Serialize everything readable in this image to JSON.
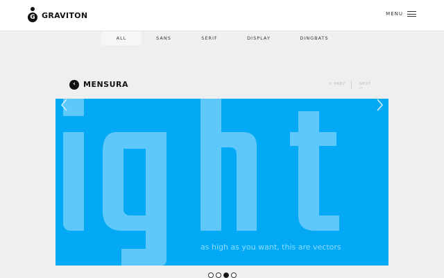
{
  "header": {
    "logo_text": "GRAVITON",
    "logo_mark_letter": "G",
    "menu_label": "MENU"
  },
  "categories": [
    {
      "label": "ALL",
      "active": true
    },
    {
      "label": "SANS",
      "active": false
    },
    {
      "label": "SERIF",
      "active": false
    },
    {
      "label": "DISPLAY",
      "active": false
    },
    {
      "label": "DINGBATS",
      "active": false
    }
  ],
  "font_view": {
    "back_icon": "chevron-left-icon",
    "font_name": "MENSURA",
    "prev_label": "< PREV",
    "next_label": "NEXT >"
  },
  "slide": {
    "display_text": "ight",
    "caption": "as high as you want, this are vectors",
    "background_color": "#03a9f4",
    "glyph_color": "#5ec8fb",
    "caption_color": "#8fdcff",
    "left_arrow_icon": "chevron-left-icon",
    "right_arrow_icon": "chevron-right-icon"
  },
  "pager": {
    "count": 4,
    "active_index": 2
  },
  "colors": {
    "page_bg": "#efefef",
    "header_bg": "#ffffff",
    "text_dark": "#111111",
    "muted": "#bcbcbc"
  }
}
